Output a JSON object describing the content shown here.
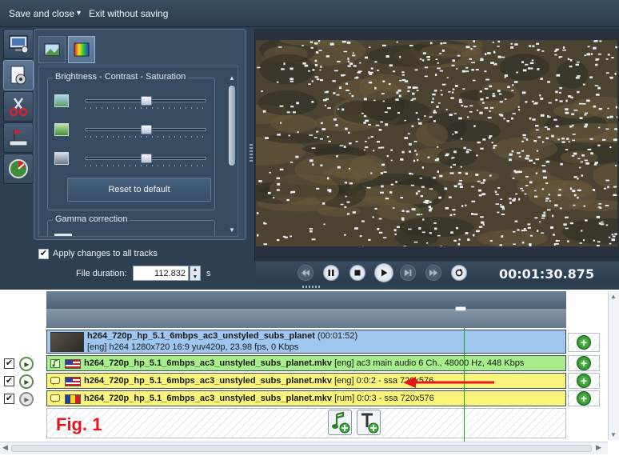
{
  "toolbar": {
    "save_close": "Save and close",
    "exit_without_saving": "Exit without saving"
  },
  "left_tabs": [
    "monitor-icon",
    "media-file-icon",
    "scissors-icon",
    "markers-icon",
    "gauge-icon"
  ],
  "panel": {
    "tabs": [
      "image-adjust-icon",
      "color-palette-icon"
    ],
    "group_bcs_label": "Brightness - Contrast - Saturation",
    "sliders": [
      {
        "name": "brightness",
        "level": 0.5
      },
      {
        "name": "contrast",
        "level": 0.5
      },
      {
        "name": "saturation",
        "level": 0.5
      }
    ],
    "reset_label": "Reset to default",
    "group_gamma_label": "Gamma correction",
    "apply_all_label": "Apply changes to all tracks",
    "apply_all_checked": true,
    "duration_label": "File duration:",
    "duration_value": "112.832",
    "duration_unit": "s"
  },
  "player": {
    "timecode": "00:01:30.875",
    "controls": [
      "rewind-icon",
      "pause-icon",
      "stop-icon",
      "play-icon",
      "next-frame-icon",
      "fast-forward-icon",
      "loop-icon"
    ]
  },
  "timeline": {
    "marker_position": 0.797,
    "tracks": [
      {
        "kind": "video",
        "title": "h264_720p_hp_5.1_6mbps_ac3_unstyled_subs_planet",
        "duration": "(00:01:52)",
        "detail": "[eng] h264 1280x720 16:9 yuv420p, 23.98 fps, 0 Kbps"
      },
      {
        "kind": "audio",
        "title": "h264_720p_hp_5.1_6mbps_ac3_unstyled_subs_planet.mkv",
        "detail": "[eng] ac3 main audio 6 Ch., 48000 Hz, 448 Kbps",
        "checked": true
      },
      {
        "kind": "subtitle",
        "title": "h264_720p_hp_5.1_6mbps_ac3_unstyled_subs_planet.mkv",
        "detail": "[eng] 0:0:2 - ssa 720x576",
        "checked": true
      },
      {
        "kind": "subtitle",
        "title": "h264_720p_hp_5.1_6mbps_ac3_unstyled_subs_planet.mkv",
        "detail": "[rum] 0:0:3 - ssa 720x576",
        "checked": true
      }
    ],
    "fig_label": "Fig. 1"
  },
  "colors": {
    "video_track": "#9ec6ee",
    "audio_track": "#a7ee8b",
    "subtitle_track": "#fbf47a",
    "playhead": "#1aa61a",
    "annotation": "#e8141e"
  }
}
